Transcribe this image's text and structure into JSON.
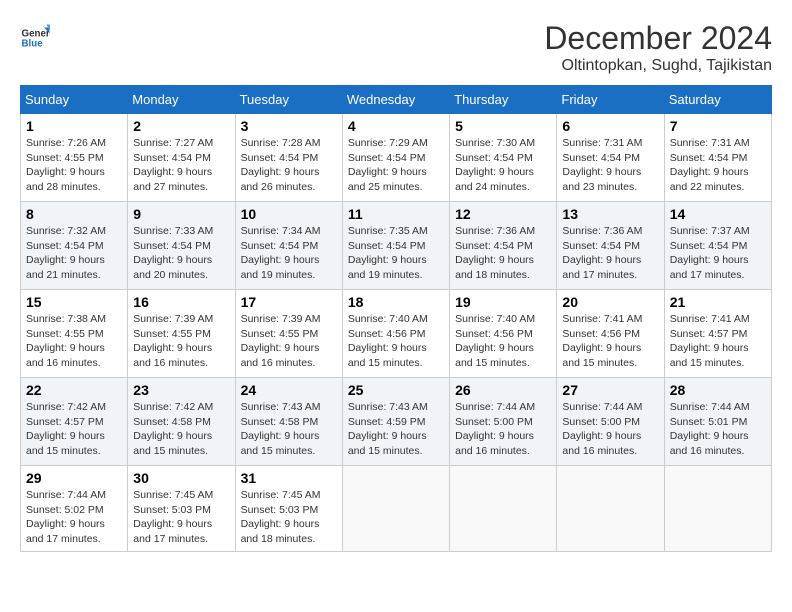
{
  "header": {
    "logo_general": "General",
    "logo_blue": "Blue",
    "month_title": "December 2024",
    "location": "Oltintopkan, Sughd, Tajikistan"
  },
  "weekdays": [
    "Sunday",
    "Monday",
    "Tuesday",
    "Wednesday",
    "Thursday",
    "Friday",
    "Saturday"
  ],
  "weeks": [
    [
      {
        "day": "1",
        "sunrise": "7:26 AM",
        "sunset": "4:55 PM",
        "daylight": "9 hours and 28 minutes."
      },
      {
        "day": "2",
        "sunrise": "7:27 AM",
        "sunset": "4:54 PM",
        "daylight": "9 hours and 27 minutes."
      },
      {
        "day": "3",
        "sunrise": "7:28 AM",
        "sunset": "4:54 PM",
        "daylight": "9 hours and 26 minutes."
      },
      {
        "day": "4",
        "sunrise": "7:29 AM",
        "sunset": "4:54 PM",
        "daylight": "9 hours and 25 minutes."
      },
      {
        "day": "5",
        "sunrise": "7:30 AM",
        "sunset": "4:54 PM",
        "daylight": "9 hours and 24 minutes."
      },
      {
        "day": "6",
        "sunrise": "7:31 AM",
        "sunset": "4:54 PM",
        "daylight": "9 hours and 23 minutes."
      },
      {
        "day": "7",
        "sunrise": "7:31 AM",
        "sunset": "4:54 PM",
        "daylight": "9 hours and 22 minutes."
      }
    ],
    [
      {
        "day": "8",
        "sunrise": "7:32 AM",
        "sunset": "4:54 PM",
        "daylight": "9 hours and 21 minutes."
      },
      {
        "day": "9",
        "sunrise": "7:33 AM",
        "sunset": "4:54 PM",
        "daylight": "9 hours and 20 minutes."
      },
      {
        "day": "10",
        "sunrise": "7:34 AM",
        "sunset": "4:54 PM",
        "daylight": "9 hours and 19 minutes."
      },
      {
        "day": "11",
        "sunrise": "7:35 AM",
        "sunset": "4:54 PM",
        "daylight": "9 hours and 19 minutes."
      },
      {
        "day": "12",
        "sunrise": "7:36 AM",
        "sunset": "4:54 PM",
        "daylight": "9 hours and 18 minutes."
      },
      {
        "day": "13",
        "sunrise": "7:36 AM",
        "sunset": "4:54 PM",
        "daylight": "9 hours and 17 minutes."
      },
      {
        "day": "14",
        "sunrise": "7:37 AM",
        "sunset": "4:54 PM",
        "daylight": "9 hours and 17 minutes."
      }
    ],
    [
      {
        "day": "15",
        "sunrise": "7:38 AM",
        "sunset": "4:55 PM",
        "daylight": "9 hours and 16 minutes."
      },
      {
        "day": "16",
        "sunrise": "7:39 AM",
        "sunset": "4:55 PM",
        "daylight": "9 hours and 16 minutes."
      },
      {
        "day": "17",
        "sunrise": "7:39 AM",
        "sunset": "4:55 PM",
        "daylight": "9 hours and 16 minutes."
      },
      {
        "day": "18",
        "sunrise": "7:40 AM",
        "sunset": "4:56 PM",
        "daylight": "9 hours and 15 minutes."
      },
      {
        "day": "19",
        "sunrise": "7:40 AM",
        "sunset": "4:56 PM",
        "daylight": "9 hours and 15 minutes."
      },
      {
        "day": "20",
        "sunrise": "7:41 AM",
        "sunset": "4:56 PM",
        "daylight": "9 hours and 15 minutes."
      },
      {
        "day": "21",
        "sunrise": "7:41 AM",
        "sunset": "4:57 PM",
        "daylight": "9 hours and 15 minutes."
      }
    ],
    [
      {
        "day": "22",
        "sunrise": "7:42 AM",
        "sunset": "4:57 PM",
        "daylight": "9 hours and 15 minutes."
      },
      {
        "day": "23",
        "sunrise": "7:42 AM",
        "sunset": "4:58 PM",
        "daylight": "9 hours and 15 minutes."
      },
      {
        "day": "24",
        "sunrise": "7:43 AM",
        "sunset": "4:58 PM",
        "daylight": "9 hours and 15 minutes."
      },
      {
        "day": "25",
        "sunrise": "7:43 AM",
        "sunset": "4:59 PM",
        "daylight": "9 hours and 15 minutes."
      },
      {
        "day": "26",
        "sunrise": "7:44 AM",
        "sunset": "5:00 PM",
        "daylight": "9 hours and 16 minutes."
      },
      {
        "day": "27",
        "sunrise": "7:44 AM",
        "sunset": "5:00 PM",
        "daylight": "9 hours and 16 minutes."
      },
      {
        "day": "28",
        "sunrise": "7:44 AM",
        "sunset": "5:01 PM",
        "daylight": "9 hours and 16 minutes."
      }
    ],
    [
      {
        "day": "29",
        "sunrise": "7:44 AM",
        "sunset": "5:02 PM",
        "daylight": "9 hours and 17 minutes."
      },
      {
        "day": "30",
        "sunrise": "7:45 AM",
        "sunset": "5:03 PM",
        "daylight": "9 hours and 17 minutes."
      },
      {
        "day": "31",
        "sunrise": "7:45 AM",
        "sunset": "5:03 PM",
        "daylight": "9 hours and 18 minutes."
      },
      null,
      null,
      null,
      null
    ]
  ],
  "labels": {
    "sunrise": "Sunrise:",
    "sunset": "Sunset:",
    "daylight": "Daylight:"
  }
}
